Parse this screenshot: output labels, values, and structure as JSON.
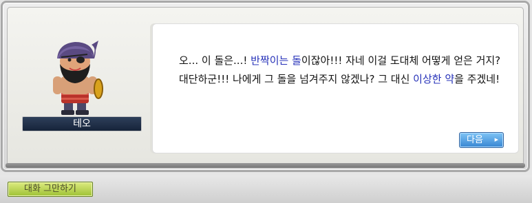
{
  "npc": {
    "name": "테오",
    "portrait": "bearded-pirate-npc-sprite"
  },
  "dialog": {
    "segments": [
      "오... 이 돌은...! ",
      "반짝이는 돌",
      "이잖아!!! 자네 이걸 도대체 어떻게 얻은 거지? 대단하군!!! 나에게 그 돌을 넘겨주지 않겠나? 그 대신 ",
      "이상한 약",
      "을 주겠네!"
    ],
    "highlight_color": "#2530b8"
  },
  "buttons": {
    "next_label": "다음",
    "next_arrow": "▶",
    "end_chat_label": "대화 그만하기"
  }
}
